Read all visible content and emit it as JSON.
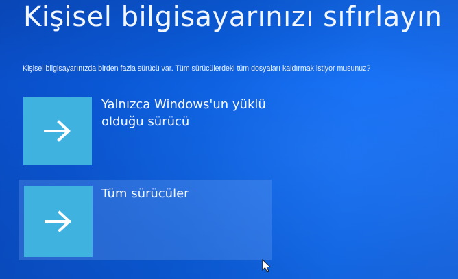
{
  "screen": {
    "title": "Kişisel bilgisayarınızı sıfırlayın",
    "question": "Kişisel bilgisayarınızda birden fazla sürücü var. Tüm sürücülerdeki tüm dosyaları kaldırmak istiyor musunuz?"
  },
  "options": [
    {
      "label": "Yalnızca Windows'un yüklü olduğu sürücü",
      "icon": "arrow-right-icon"
    },
    {
      "label": "Tüm sürücüler",
      "icon": "arrow-right-icon",
      "state": "hover"
    }
  ],
  "colors": {
    "background": "#0b5fe0",
    "tile": "#3fb2df",
    "hover_highlight": "#78aaf5"
  }
}
